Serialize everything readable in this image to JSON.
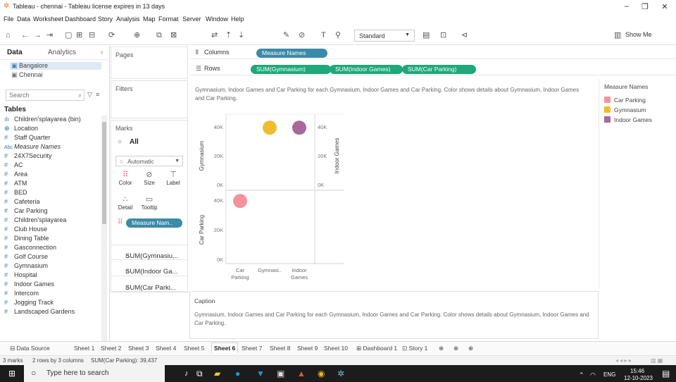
{
  "window": {
    "title": "Tableau - chennai - Tableau license expires in 13 days"
  },
  "menu": [
    "File",
    "Data",
    "Worksheet",
    "Dashboard",
    "Story",
    "Analysis",
    "Map",
    "Format",
    "Server",
    "Window",
    "Help"
  ],
  "toolbar": {
    "fit_dropdown": "Standard",
    "show_me": "Show Me"
  },
  "data_pane": {
    "tabs": [
      "Data",
      "Analytics"
    ],
    "datasources": [
      "Bangalore",
      "Chennai"
    ],
    "search_placeholder": "Search",
    "tables_label": "Tables",
    "fields": [
      {
        "type": "bin",
        "name": "Children'splayarea (bin)"
      },
      {
        "type": "geo",
        "name": "Location"
      },
      {
        "type": "#",
        "name": "Staff Quarter"
      },
      {
        "type": "Abc",
        "name": "Measure Names"
      },
      {
        "type": "#",
        "name": "24X7Security"
      },
      {
        "type": "#",
        "name": "AC"
      },
      {
        "type": "#",
        "name": "Area"
      },
      {
        "type": "#",
        "name": "ATM"
      },
      {
        "type": "#",
        "name": "BED"
      },
      {
        "type": "#",
        "name": "Cafeteria"
      },
      {
        "type": "#",
        "name": "Car Parking"
      },
      {
        "type": "#",
        "name": "Children'splayarea"
      },
      {
        "type": "#",
        "name": "Club House"
      },
      {
        "type": "#",
        "name": "Dining Table"
      },
      {
        "type": "#",
        "name": "Gasconnection"
      },
      {
        "type": "#",
        "name": "Golf Course"
      },
      {
        "type": "#",
        "name": "Gymnasium"
      },
      {
        "type": "#",
        "name": "Hospital"
      },
      {
        "type": "#",
        "name": "Indoor Games"
      },
      {
        "type": "#",
        "name": "Intercom"
      },
      {
        "type": "#",
        "name": "Jogging Track"
      },
      {
        "type": "#",
        "name": "Landscaped Gardens"
      }
    ]
  },
  "cards": {
    "pages": "Pages",
    "filters": "Filters",
    "marks": "Marks",
    "marks_all": "All",
    "mark_type": "Automatic",
    "buttons": [
      "Color",
      "Size",
      "Label",
      "Detail",
      "Tooltip"
    ],
    "color_pill": "Measure Nam..",
    "sum_rows": [
      "SUM(Gymnasiu...",
      "SUM(Indoor Ga...",
      "SUM(Car Parki..."
    ]
  },
  "shelves": {
    "columns_label": "Columns",
    "rows_label": "Rows",
    "columns_pills": [
      "Measure Names"
    ],
    "rows_pills": [
      "SUM(Gymnasium)",
      "SUM(Indoor Games)",
      "SUM(Car Parking)"
    ]
  },
  "view": {
    "title": "Gymnasium, Indoor Games and Car Parking for each Gymnasium, Indoor Games and Car Parking.  Color shows details about Gymnasium, Indoor Games and Car Parking."
  },
  "legend": {
    "title": "Measure Names",
    "items": [
      {
        "name": "Car Parking",
        "color": "#f4939b"
      },
      {
        "name": "Gymnasium",
        "color": "#efbd2e"
      },
      {
        "name": "Indoor Games",
        "color": "#a8689c"
      }
    ]
  },
  "caption": {
    "title": "Caption",
    "text": "Gymnasium, Indoor Games and Car Parking for each Gymnasium, Indoor Games and Car Parking.  Color shows details about Gymnasium, Indoor Games and Car Parking."
  },
  "chart_data": {
    "type": "scatter",
    "categories": [
      "Car Parking",
      "Gymnasi..",
      "Indoor Games"
    ],
    "panes": [
      {
        "ylabel": "Gymnasium",
        "ylim": [
          0,
          40000
        ],
        "ticks": [
          "40K",
          "20K",
          "0K"
        ],
        "points": [
          {
            "category": "Gymnasi..",
            "value": 39437,
            "color": "#efbd2e"
          }
        ]
      },
      {
        "ylabel": "Indoor Games",
        "ylim": [
          0,
          40000
        ],
        "ticks": [
          "40K",
          "20K",
          "0K"
        ],
        "points": [
          {
            "category": "Indoor Games",
            "value": 39437,
            "color": "#a8689c"
          }
        ]
      },
      {
        "ylabel": "Car Parking",
        "ylim": [
          0,
          40000
        ],
        "ticks": [
          "40K",
          "20K",
          "0K"
        ],
        "points": [
          {
            "category": "Car Parking",
            "value": 39437,
            "color": "#f4939b"
          }
        ]
      }
    ]
  },
  "sheet_tabs": [
    "Data Source",
    "Sheet 1",
    "Sheet 2",
    "Sheet 3",
    "Sheet 4",
    "Sheet 5",
    "Sheet 6",
    "Sheet 7",
    "Sheet 8",
    "Sheet 9",
    "Sheet 10",
    "Dashboard 1",
    "Story 1"
  ],
  "active_sheet": "Sheet 6",
  "status": {
    "marks": "3 marks",
    "rows": "2 rows by 3 columns",
    "sum": "SUM(Car Parking): 39,437"
  },
  "taskbar": {
    "search_placeholder": "Type here to search",
    "lang": "ENG",
    "time": "15:46",
    "date": "12-10-2023"
  }
}
